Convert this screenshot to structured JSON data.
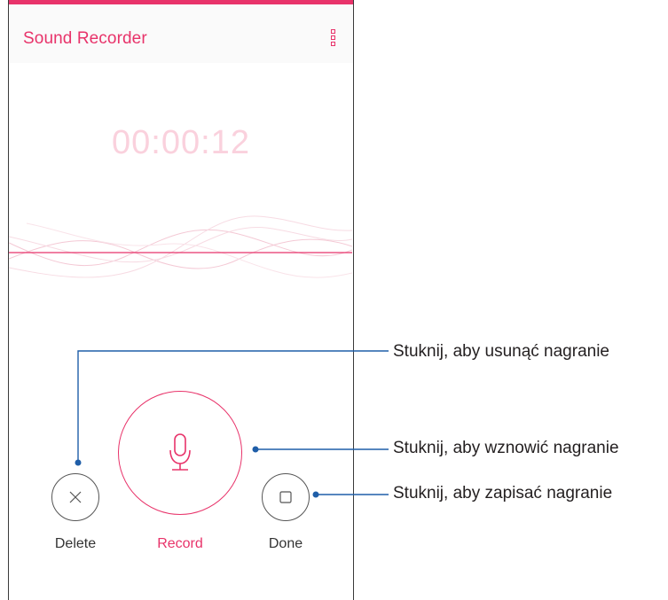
{
  "app": {
    "title": "Sound Recorder",
    "accent_color": "#e8336a",
    "timer": "00:00:12",
    "menu_icon": "overflow-menu-icon"
  },
  "controls": {
    "delete": {
      "label": "Delete",
      "icon": "close-icon"
    },
    "record": {
      "label": "Record",
      "icon": "microphone-icon"
    },
    "done": {
      "label": "Done",
      "icon": "stop-square-icon"
    }
  },
  "callouts": [
    {
      "text": "Stuknij, aby usunąć nagranie"
    },
    {
      "text": "Stuknij, aby wznowić nagranie"
    },
    {
      "text": "Stuknij, aby zapisać nagranie"
    }
  ],
  "callout_color": "#1f5ea8"
}
